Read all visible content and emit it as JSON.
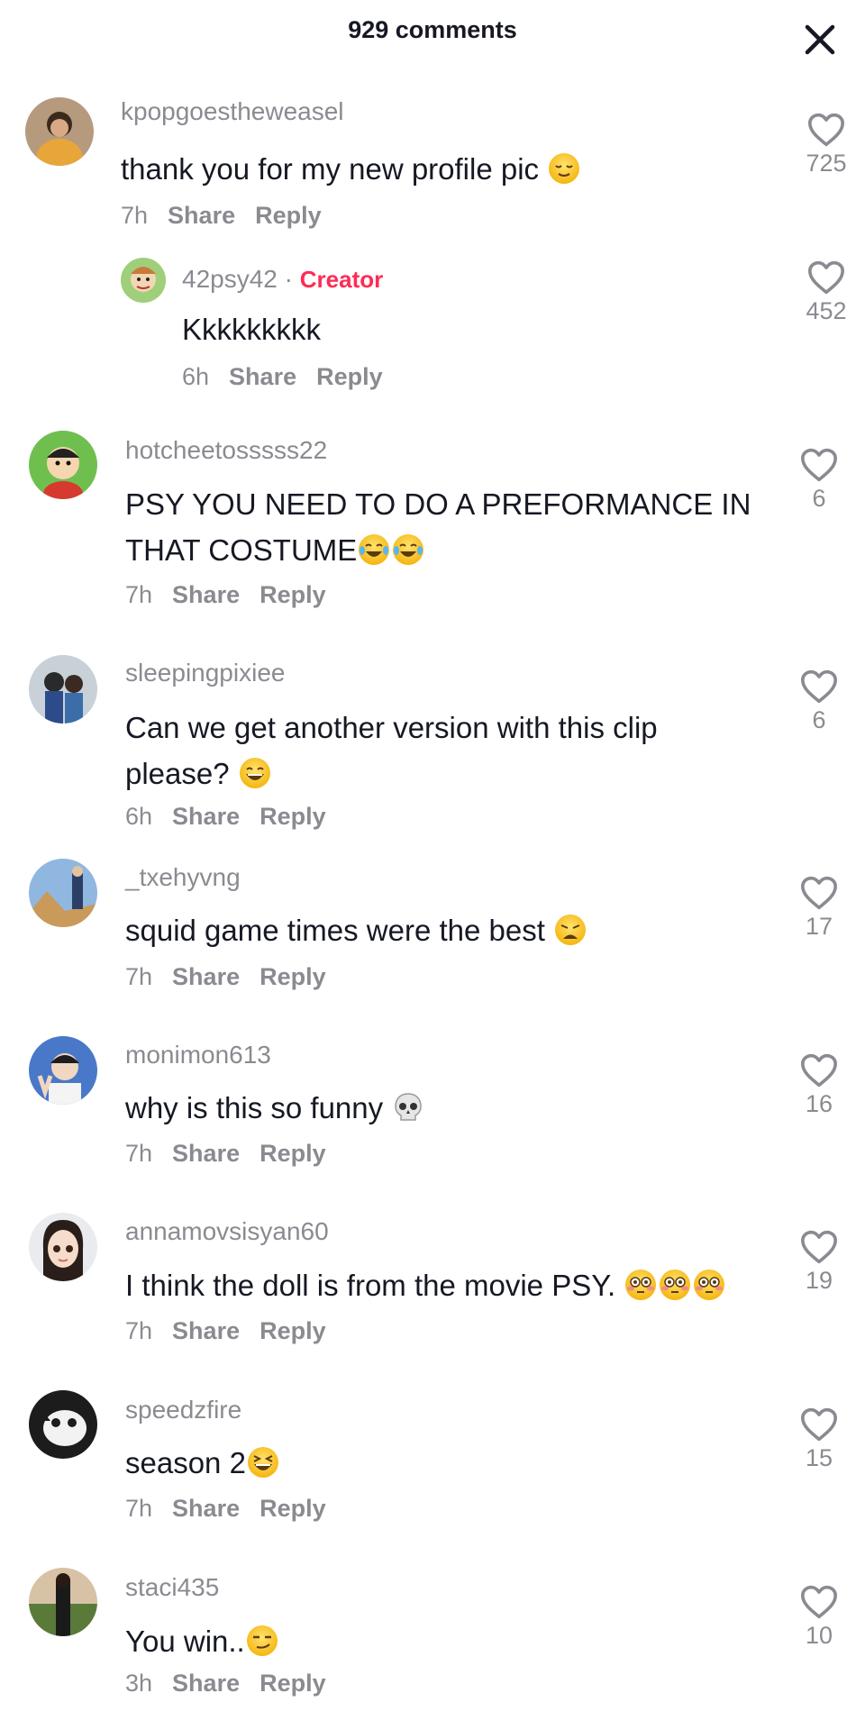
{
  "header": {
    "title": "929 comments"
  },
  "comments": [
    {
      "username": "kpopgoestheweasel",
      "text": "thank you for my new profile pic",
      "time": "7h",
      "share": "Share",
      "reply": "Reply",
      "likes": "725"
    },
    {
      "username": "42psy42",
      "creator_sep": " · ",
      "creator_label": "Creator",
      "text": "Kkkkkkkkk",
      "time": "6h",
      "share": "Share",
      "reply": "Reply",
      "likes": "452"
    },
    {
      "username": "hotcheetosssss22",
      "text_line1": "PSY YOU NEED TO DO A PREFORMANCE IN",
      "text_line2": "THAT COSTUME",
      "time": "7h",
      "share": "Share",
      "reply": "Reply",
      "likes": "6"
    },
    {
      "username": "sleepingpixiee",
      "text_line1": "Can we get another version with this clip",
      "text_line2": "please?",
      "time": "6h",
      "share": "Share",
      "reply": "Reply",
      "likes": "6"
    },
    {
      "username": "_txehyvng",
      "text": "squid game times were the best",
      "time": "7h",
      "share": "Share",
      "reply": "Reply",
      "likes": "17"
    },
    {
      "username": "monimon613",
      "text": "why is this so funny",
      "time": "7h",
      "share": "Share",
      "reply": "Reply",
      "likes": "16"
    },
    {
      "username": "annamovsisyan60",
      "text": "I think the doll is from the movie PSY.",
      "time": "7h",
      "share": "Share",
      "reply": "Reply",
      "likes": "19"
    },
    {
      "username": "speedzfire",
      "text": "season 2",
      "time": "7h",
      "share": "Share",
      "reply": "Reply",
      "likes": "15"
    },
    {
      "username": "staci435",
      "text": "You win..",
      "time": "3h",
      "share": "Share",
      "reply": "Reply",
      "likes": "10"
    }
  ]
}
